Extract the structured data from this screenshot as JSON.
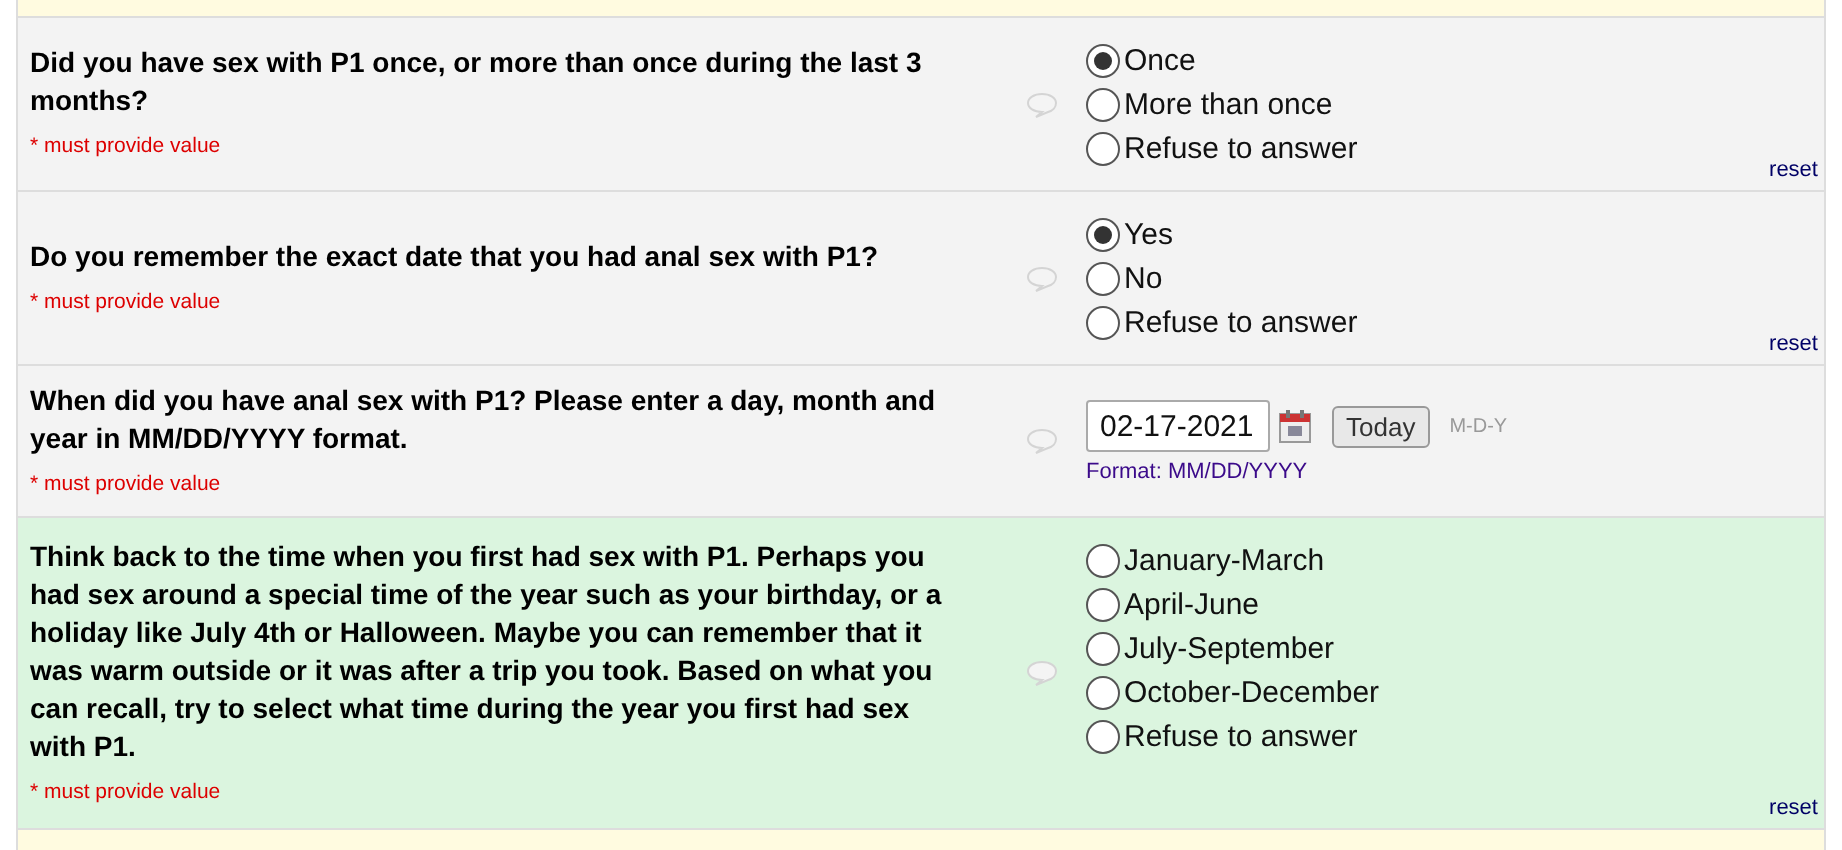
{
  "questions": [
    {
      "kind": "radio",
      "highlighted": false,
      "label": "Did you have sex with P1 once, or more than once during the last 3 months?",
      "required_note": "* must provide value",
      "reset": "reset",
      "options": [
        {
          "label": "Once",
          "selected": true
        },
        {
          "label": "More than once",
          "selected": false
        },
        {
          "label": "Refuse to answer",
          "selected": false
        }
      ]
    },
    {
      "kind": "radio",
      "highlighted": false,
      "label": "Do you remember the exact date that you had anal sex with P1?",
      "required_note": "* must provide value",
      "reset": "reset",
      "options": [
        {
          "label": "Yes",
          "selected": true
        },
        {
          "label": "No",
          "selected": false
        },
        {
          "label": "Refuse to answer",
          "selected": false
        }
      ]
    },
    {
      "kind": "date",
      "highlighted": false,
      "label": "When did you have anal sex with P1? Please enter a day, month and year in MM/DD/YYYY format.",
      "required_note": "* must provide value",
      "value": "02-17-2021",
      "today_button": "Today",
      "format_hint": "M-D-Y",
      "format_note": "Format: MM/DD/YYYY"
    },
    {
      "kind": "radio",
      "highlighted": true,
      "label": "Think back to the time when you first had sex with P1. Perhaps you had sex around a special time of the year such as your birthday, or a holiday like July 4th or Halloween. Maybe you can remember that it was warm outside or it was after a trip you took. Based on what you can recall, try to select what time during the year you first had sex with P1.",
      "required_note": "* must provide value",
      "reset": "reset",
      "options": [
        {
          "label": "January-March",
          "selected": false
        },
        {
          "label": "April-June",
          "selected": false
        },
        {
          "label": "July-September",
          "selected": false
        },
        {
          "label": "October-December",
          "selected": false
        },
        {
          "label": "Refuse to answer",
          "selected": false
        }
      ]
    }
  ]
}
